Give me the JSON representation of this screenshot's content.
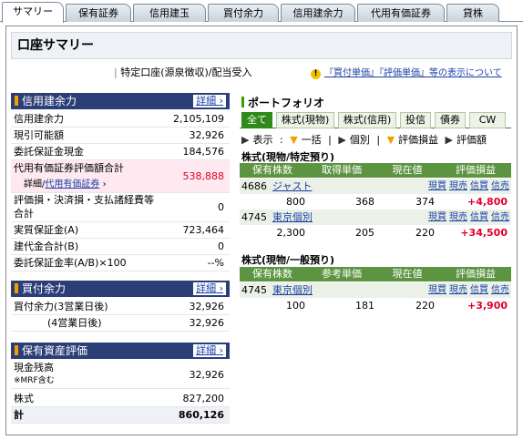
{
  "tabs": [
    "サマリー",
    "保有証券",
    "信用建玉",
    "買付余力",
    "信用建余力",
    "代用有価証券",
    "貸株"
  ],
  "title": "口座サマリー",
  "account_type": "特定口座(源泉徴収)/配当受入",
  "notice": "『買付単価』『評価単価』等の表示について",
  "credit_capacity": {
    "heading": "信用建余力",
    "detail": "詳細",
    "rows": [
      {
        "label": "信用建余力",
        "value": "2,105,109"
      },
      {
        "label": "現引可能額",
        "value": "32,926"
      },
      {
        "label": "委託保証金現金",
        "value": "184,576"
      },
      {
        "label": "代用有価証券評価額合計",
        "value": "538,888"
      },
      {
        "label_prefix": "詳細/",
        "label_link": "代用有価証券"
      },
      {
        "label": "評価損・決済損・支払諸経費等",
        "label2": "合計",
        "value": "0"
      },
      {
        "label": "実質保証金(A)",
        "value": "723,464"
      },
      {
        "label": "建代金合計(B)",
        "value": "0"
      },
      {
        "label": "委託保証金率(A/B)×100",
        "value": "--%"
      }
    ]
  },
  "buying_power": {
    "heading": "買付余力",
    "detail": "詳細",
    "rows": [
      {
        "label": "買付余力(3営業日後)",
        "value": "32,926"
      },
      {
        "label": "(4営業日後)",
        "value": "32,926"
      }
    ]
  },
  "assets": {
    "heading": "保有資産評価",
    "detail": "詳細",
    "rows": [
      {
        "label": "現金残高",
        "sub": "※MRF含む",
        "value": "32,926"
      },
      {
        "label": "株式",
        "value": "827,200"
      },
      {
        "label": "計",
        "value": "860,126"
      }
    ]
  },
  "portfolio": {
    "heading": "ポートフォリオ",
    "tabs": [
      "全て",
      "株式(現物)",
      "株式(信用)",
      "投信",
      "債券",
      "CW"
    ],
    "controls": [
      "表示",
      "一括",
      "個別",
      "評価損益",
      "評価額"
    ],
    "sections": [
      {
        "title": "株式(現物/特定預り)",
        "headers": [
          "保有株数",
          "取得単価",
          "現在値",
          "評価損益"
        ],
        "holdings": [
          {
            "code": "4686",
            "name": "ジャスト",
            "actions": [
              "現買",
              "現売",
              "信買",
              "信売"
            ],
            "qty": "800",
            "price": "368",
            "current": "374",
            "pl": "+4,800"
          },
          {
            "code": "4745",
            "name": "東京個別",
            "actions": [
              "現買",
              "現売",
              "信買",
              "信売"
            ],
            "qty": "2,300",
            "price": "205",
            "current": "220",
            "pl": "+34,500"
          }
        ]
      },
      {
        "title": "株式(現物/一般預り)",
        "headers": [
          "保有株数",
          "参考単価",
          "現在値",
          "評価損益"
        ],
        "holdings": [
          {
            "code": "4745",
            "name": "東京個別",
            "actions": [
              "現買",
              "現売",
              "信買",
              "信売"
            ],
            "qty": "100",
            "price": "181",
            "current": "220",
            "pl": "+3,900"
          }
        ]
      }
    ]
  },
  "colors": {
    "navy_header": "#2c3e78",
    "green_header": "#5c9442",
    "profit_red": "#e0002a",
    "link_blue": "#1a3fa8"
  }
}
